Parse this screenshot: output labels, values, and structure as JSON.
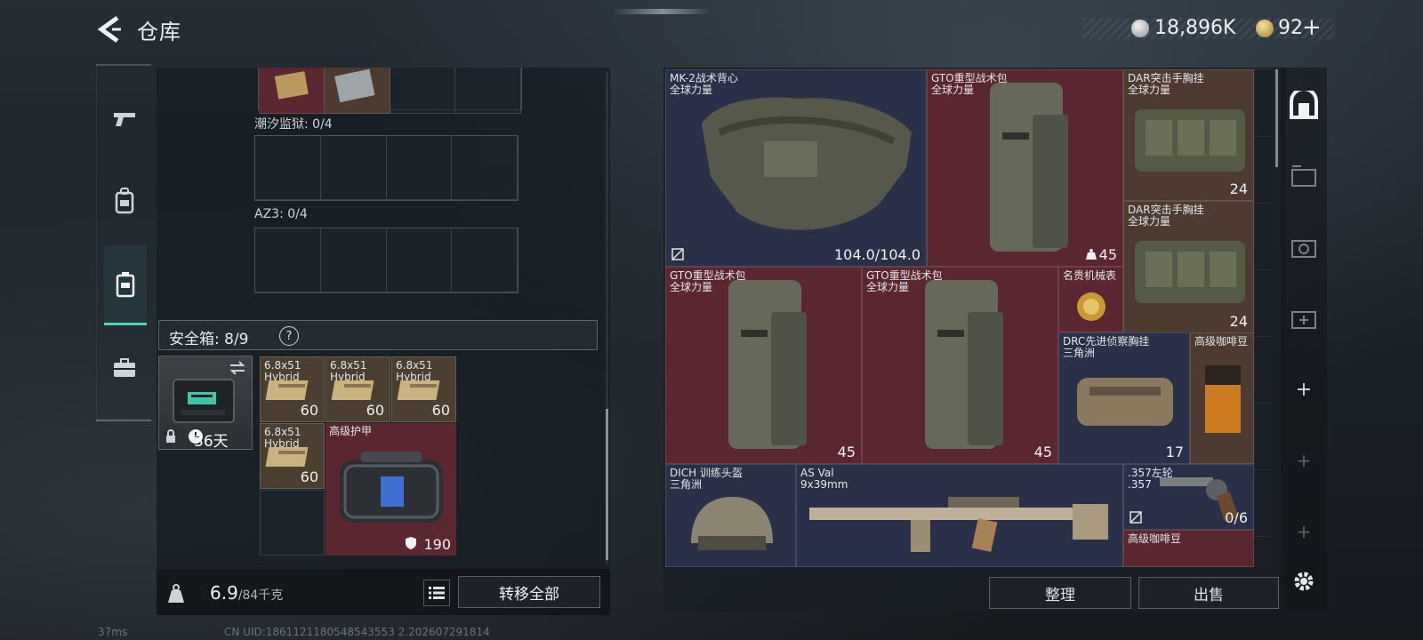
{
  "header": {
    "title": "仓库",
    "currency_silver": "18,896K",
    "currency_gold": "92",
    "gold_plus": "+"
  },
  "left_panel": {
    "sections": [
      {
        "label": "潮汐监狱: 0/4"
      },
      {
        "label": "AZ3: 0/4"
      }
    ],
    "safebox": {
      "title": "安全箱: 8/9",
      "help": "?",
      "days": "36天"
    },
    "items": [
      {
        "name": "6.8x51\nHybrid",
        "qty": "60"
      },
      {
        "name": "6.8x51\nHybrid",
        "qty": "60"
      },
      {
        "name": "6.8x51\nHybrid",
        "qty": "60"
      },
      {
        "name": "6.8x51\nHybrid",
        "qty": "60"
      },
      {
        "name": "高级护甲",
        "qty": "190"
      }
    ],
    "weight_value": "6.9",
    "weight_max": "/84千克",
    "transfer_all": "转移全部"
  },
  "stash": {
    "items": [
      {
        "name": "MK-2战术背心\n全球力量",
        "qty": "104.0/104.0"
      },
      {
        "name": "GTO重型战术包\n全球力量",
        "qty": "45"
      },
      {
        "name": "DAR突击手胸挂\n全球力量",
        "qty": "24"
      },
      {
        "name": "DAR突击手胸挂\n全球力量",
        "qty": "24"
      },
      {
        "name": "GTO重型战术包\n全球力量",
        "qty": "45"
      },
      {
        "name": "GTO重型战术包\n全球力量",
        "qty": "45"
      },
      {
        "name": "名贵机械表",
        "qty": ""
      },
      {
        "name": "DRC先进侦察胸挂\n三角洲",
        "qty": "17"
      },
      {
        "name": "高级咖啡豆",
        "qty": ""
      },
      {
        "name": "DICH 训练头盔\n三角洲",
        "qty": ""
      },
      {
        "name": "AS Val\n9x39mm",
        "qty": ""
      },
      {
        "name": ".357左轮\n.357",
        "qty": "0/6"
      },
      {
        "name": "高级咖啡豆",
        "qty": ""
      }
    ],
    "organize": "整理",
    "sell": "出售"
  },
  "status": {
    "ping": "37ms",
    "uid": "CN UID:1861121180548543553 2.202607291814"
  },
  "colors": {
    "accent": "#4fd6b8",
    "rarity_red": "#5a2730",
    "rarity_navy": "#2b3049",
    "rarity_brown": "#4d3b31"
  },
  "icons": [
    "back-arrow-icon",
    "silver-coin-icon",
    "gold-coin-icon",
    "pistol-icon",
    "backpack-icon",
    "safebox-icon",
    "briefcase-icon",
    "weight-icon",
    "list-icon",
    "lock-icon",
    "clock-icon",
    "swap-icon",
    "shield-icon",
    "helmet-icon",
    "durability-icon",
    "stash-icon",
    "gear-icon"
  ]
}
